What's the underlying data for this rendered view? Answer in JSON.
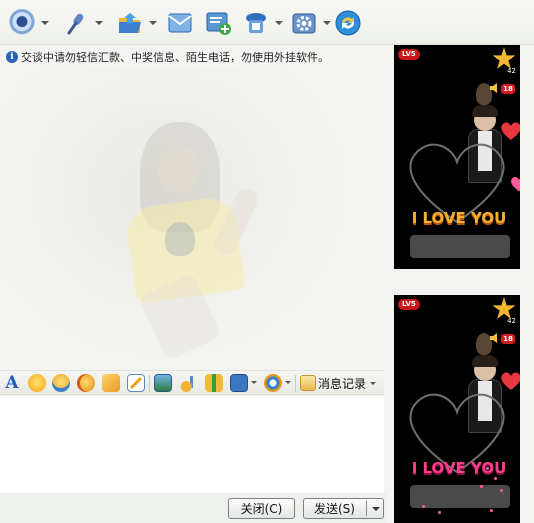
{
  "window": {
    "notice": "交谈中请勿轻信汇款、中奖信息、陌生电话，勿使用外挂软件。"
  },
  "toolbar": {
    "buttons": [
      {
        "name": "webcam",
        "has_dropdown": true
      },
      {
        "name": "voice-mic",
        "has_dropdown": true
      },
      {
        "name": "send-file",
        "has_dropdown": true
      },
      {
        "name": "send-mail",
        "has_dropdown": false
      },
      {
        "name": "create-group-chat",
        "has_dropdown": false
      },
      {
        "name": "app-plugins",
        "has_dropdown": true
      },
      {
        "name": "settings",
        "has_dropdown": true
      },
      {
        "name": "remote-assist",
        "has_dropdown": false
      }
    ]
  },
  "format_bar": {
    "icons": [
      "font-icon",
      "emoticon-icon",
      "magic-face-icon",
      "flash-face-icon",
      "shake-window-icon",
      "handwriting-icon",
      "send-image-icon",
      "music-icon",
      "gift-icon",
      "screenshot-icon",
      "payment-icon"
    ],
    "message_history": "消息记录"
  },
  "buttons": {
    "close": "关闭(C)",
    "send": "发送(S)"
  },
  "show_panel": {
    "level_badge": "LV5",
    "star_count": "42",
    "volume_badge": "18",
    "love_text": "I LOVE YOU",
    "colors": {
      "level_badge": "#c8161b",
      "star": "#f2b632",
      "love_gold": "#f4b12a",
      "love_pink": "#ff3d8b"
    }
  }
}
